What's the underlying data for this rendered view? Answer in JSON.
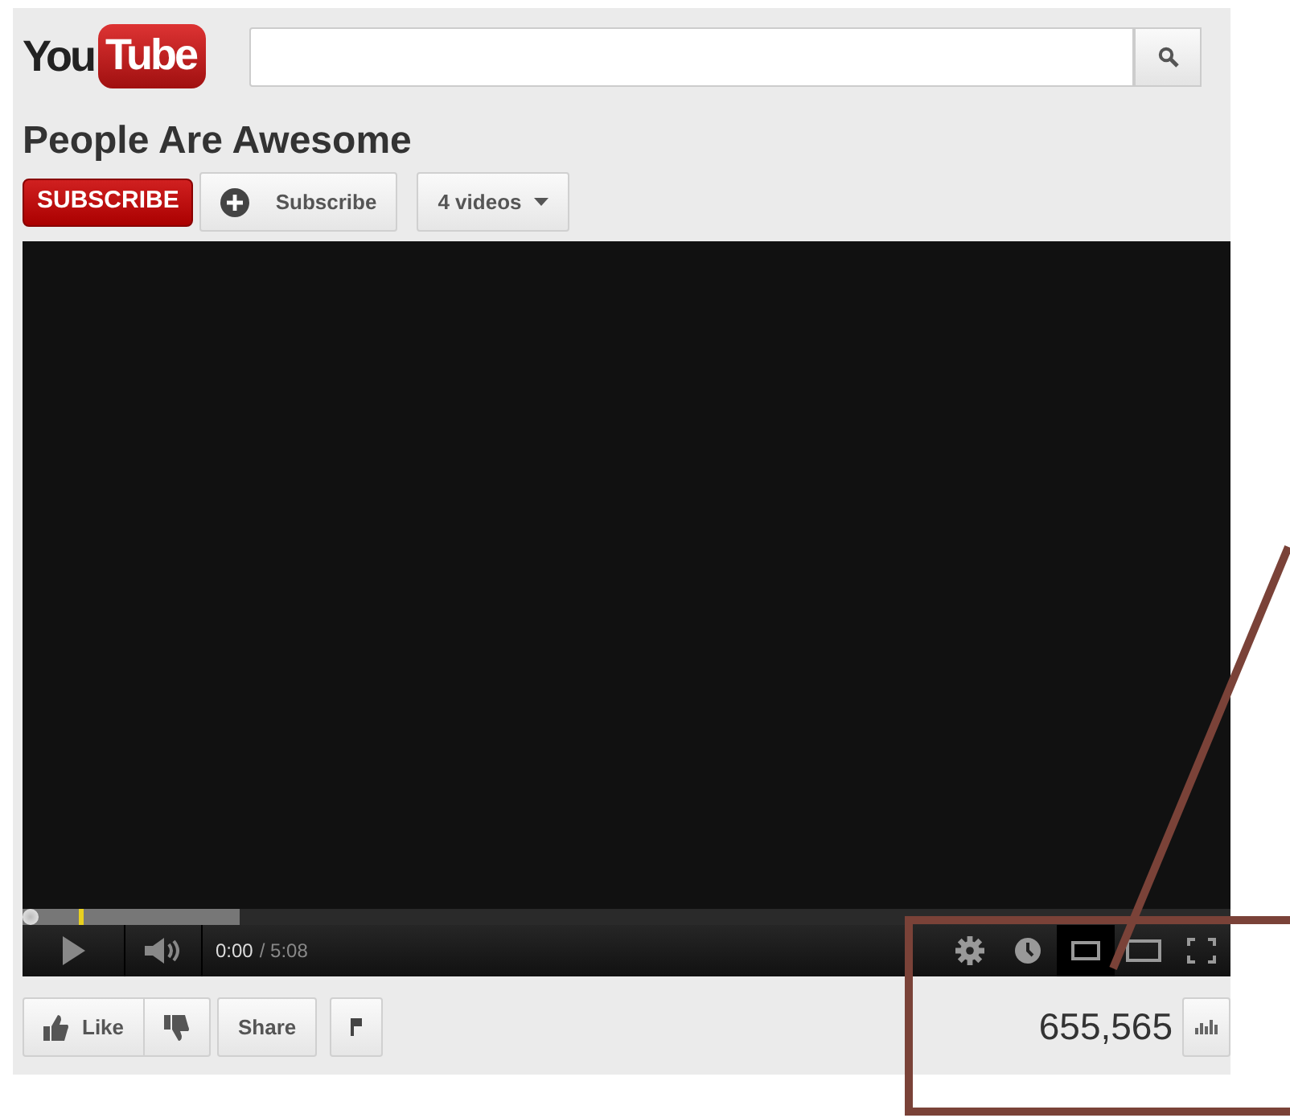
{
  "header": {
    "logo": {
      "part_1": "You",
      "part_2": "Tube"
    }
  },
  "channel": {
    "title": "People Are Awesome",
    "subscribe_badge": "SUBSCRIBE",
    "subscribe_button": "Subscribe",
    "videos_menu": "4 videos"
  },
  "player": {
    "buffered": {
      "level": 0.18
    },
    "played": {
      "level": 0
    },
    "time_current": "0:00",
    "time_total": "/ 5:08",
    "size_modes": [
      {
        "selected": true
      },
      {
        "selected": false
      }
    ]
  },
  "actions": {
    "like": "Like",
    "share": "Share",
    "view_count": "655,565"
  }
}
